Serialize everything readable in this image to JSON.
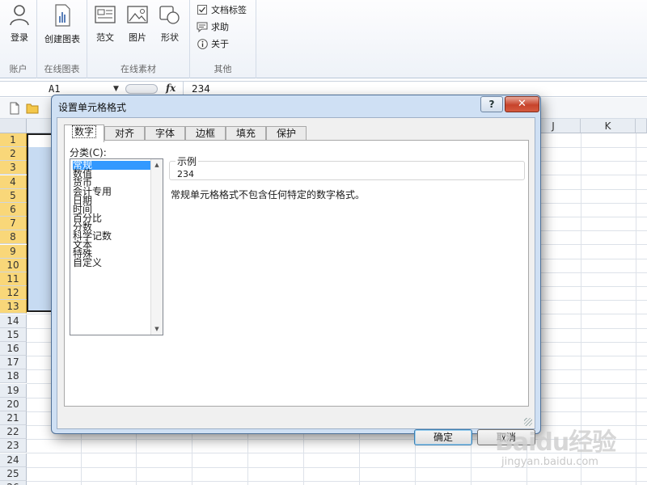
{
  "ribbon": {
    "groups": [
      {
        "label": "账户",
        "buttons": [
          {
            "label": "登录",
            "icon": "person-icon"
          }
        ]
      },
      {
        "label": "在线图表",
        "buttons": [
          {
            "label": "创建图表",
            "icon": "chart-doc-icon"
          }
        ]
      },
      {
        "label": "在线素材",
        "buttons": [
          {
            "label": "范文",
            "icon": "template-icon"
          },
          {
            "label": "图片",
            "icon": "picture-icon"
          },
          {
            "label": "形状",
            "icon": "shapes-icon"
          }
        ]
      },
      {
        "label": "其他",
        "items": [
          {
            "label": "文档标签",
            "icon": "checkbox-icon"
          },
          {
            "label": "求助",
            "icon": "chat-icon"
          },
          {
            "label": "关于",
            "icon": "info-icon"
          }
        ]
      }
    ]
  },
  "formula_bar": {
    "name_box": "A1",
    "fx": "fx",
    "value": "234"
  },
  "sheet": {
    "columns": [
      "J",
      "K"
    ],
    "rows": [
      "1",
      "2",
      "3",
      "4",
      "5",
      "6",
      "7",
      "8",
      "9",
      "10",
      "11",
      "12",
      "13",
      "14",
      "15",
      "16",
      "17",
      "18",
      "19",
      "20",
      "21",
      "22",
      "23",
      "24",
      "25",
      "26"
    ]
  },
  "dialog": {
    "title": "设置单元格格式",
    "help": "?",
    "close": "✕",
    "tabs": [
      "数字",
      "对齐",
      "字体",
      "边框",
      "填充",
      "保护"
    ],
    "category_label": "分类(C):",
    "categories": [
      "常规",
      "数值",
      "货币",
      "会计专用",
      "日期",
      "时间",
      "百分比",
      "分数",
      "科学记数",
      "文本",
      "特殊",
      "自定义"
    ],
    "selected_category": "常规",
    "sample_label": "示例",
    "sample_value": "234",
    "description": "常规单元格格式不包含任何特定的数字格式。",
    "ok": "确定",
    "cancel": "取消"
  },
  "watermark": {
    "text": "Baidu经验",
    "sub": "jingyan.baidu.com"
  }
}
